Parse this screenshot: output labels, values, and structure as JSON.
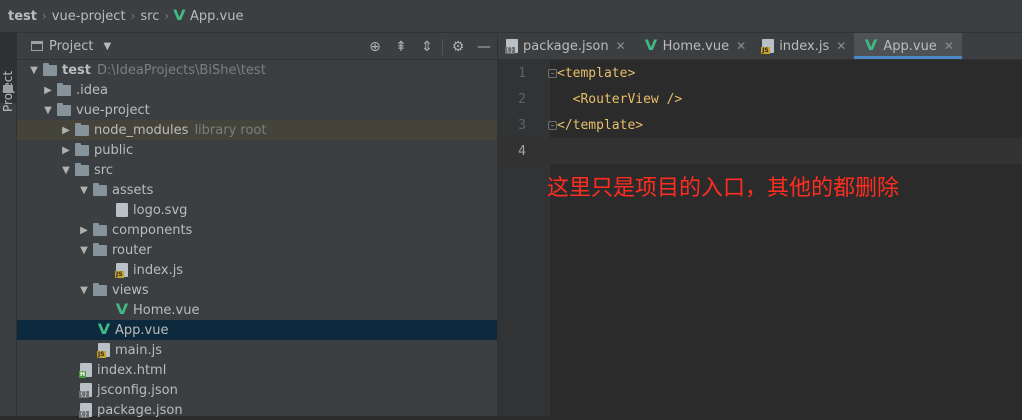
{
  "breadcrumb": {
    "items": [
      "test",
      "vue-project",
      "src",
      "App.vue"
    ]
  },
  "left_strip": {
    "label": "Project"
  },
  "project_panel": {
    "title": "Project",
    "header_icons": [
      "target-icon",
      "collapse-all-icon",
      "expand-icon",
      "gear-icon",
      "minimize-icon"
    ]
  },
  "tree": {
    "root": {
      "name": "test",
      "path": "D:\\IdeaProjects\\BiShe\\test"
    },
    "items": [
      {
        "label": ".idea",
        "note": ""
      },
      {
        "label": "vue-project",
        "note": ""
      },
      {
        "label": "node_modules",
        "note": "library root"
      },
      {
        "label": "public",
        "note": ""
      },
      {
        "label": "src",
        "note": ""
      },
      {
        "label": "assets",
        "note": ""
      },
      {
        "label": "logo.svg",
        "note": ""
      },
      {
        "label": "components",
        "note": ""
      },
      {
        "label": "router",
        "note": ""
      },
      {
        "label": "index.js",
        "note": ""
      },
      {
        "label": "views",
        "note": ""
      },
      {
        "label": "Home.vue",
        "note": ""
      },
      {
        "label": "App.vue",
        "note": ""
      },
      {
        "label": "main.js",
        "note": ""
      },
      {
        "label": "index.html",
        "note": ""
      },
      {
        "label": "jsconfig.json",
        "note": ""
      },
      {
        "label": "package.json",
        "note": ""
      }
    ]
  },
  "tabs": [
    {
      "label": "package.json",
      "icon": "json-file-icon"
    },
    {
      "label": "Home.vue",
      "icon": "vue-file-icon"
    },
    {
      "label": "index.js",
      "icon": "js-file-icon"
    },
    {
      "label": "App.vue",
      "icon": "vue-file-icon",
      "active": true
    }
  ],
  "editor": {
    "lines": [
      {
        "num": "1",
        "text": "<template>"
      },
      {
        "num": "2",
        "text": "  <RouterView />"
      },
      {
        "num": "3",
        "text": "</template>"
      },
      {
        "num": "4",
        "text": ""
      }
    ],
    "annotation": "这里只是项目的入口，其他的都删除",
    "annotation_color": "#ff2d20"
  },
  "colors": {
    "accent": "#4a88c7",
    "vue_green": "#41b883",
    "tag": "#e8bf6a",
    "selection": "#0d293e"
  }
}
